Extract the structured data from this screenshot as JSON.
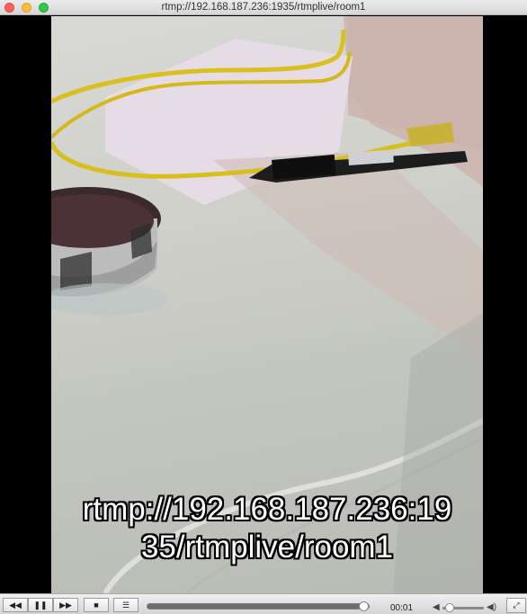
{
  "window": {
    "title": "rtmp://192.168.187.236:1935/rtmplive/room1"
  },
  "video": {
    "overlay_line1": "rtmp://192.168.187.236:19",
    "overlay_line2": "35/rtmplive/room1"
  },
  "controls": {
    "rewind_icon": "◀◀",
    "pause_icon": "❚❚",
    "forward_icon": "▶▶",
    "stop_icon": "■",
    "playlist_icon": "☰",
    "elapsed_time": "00:01",
    "seek_progress": 0.98,
    "volume_level": 0.1,
    "vol_low_icon": "◀",
    "vol_high_icon": "◀)",
    "fullscreen_icon": "⤢"
  }
}
